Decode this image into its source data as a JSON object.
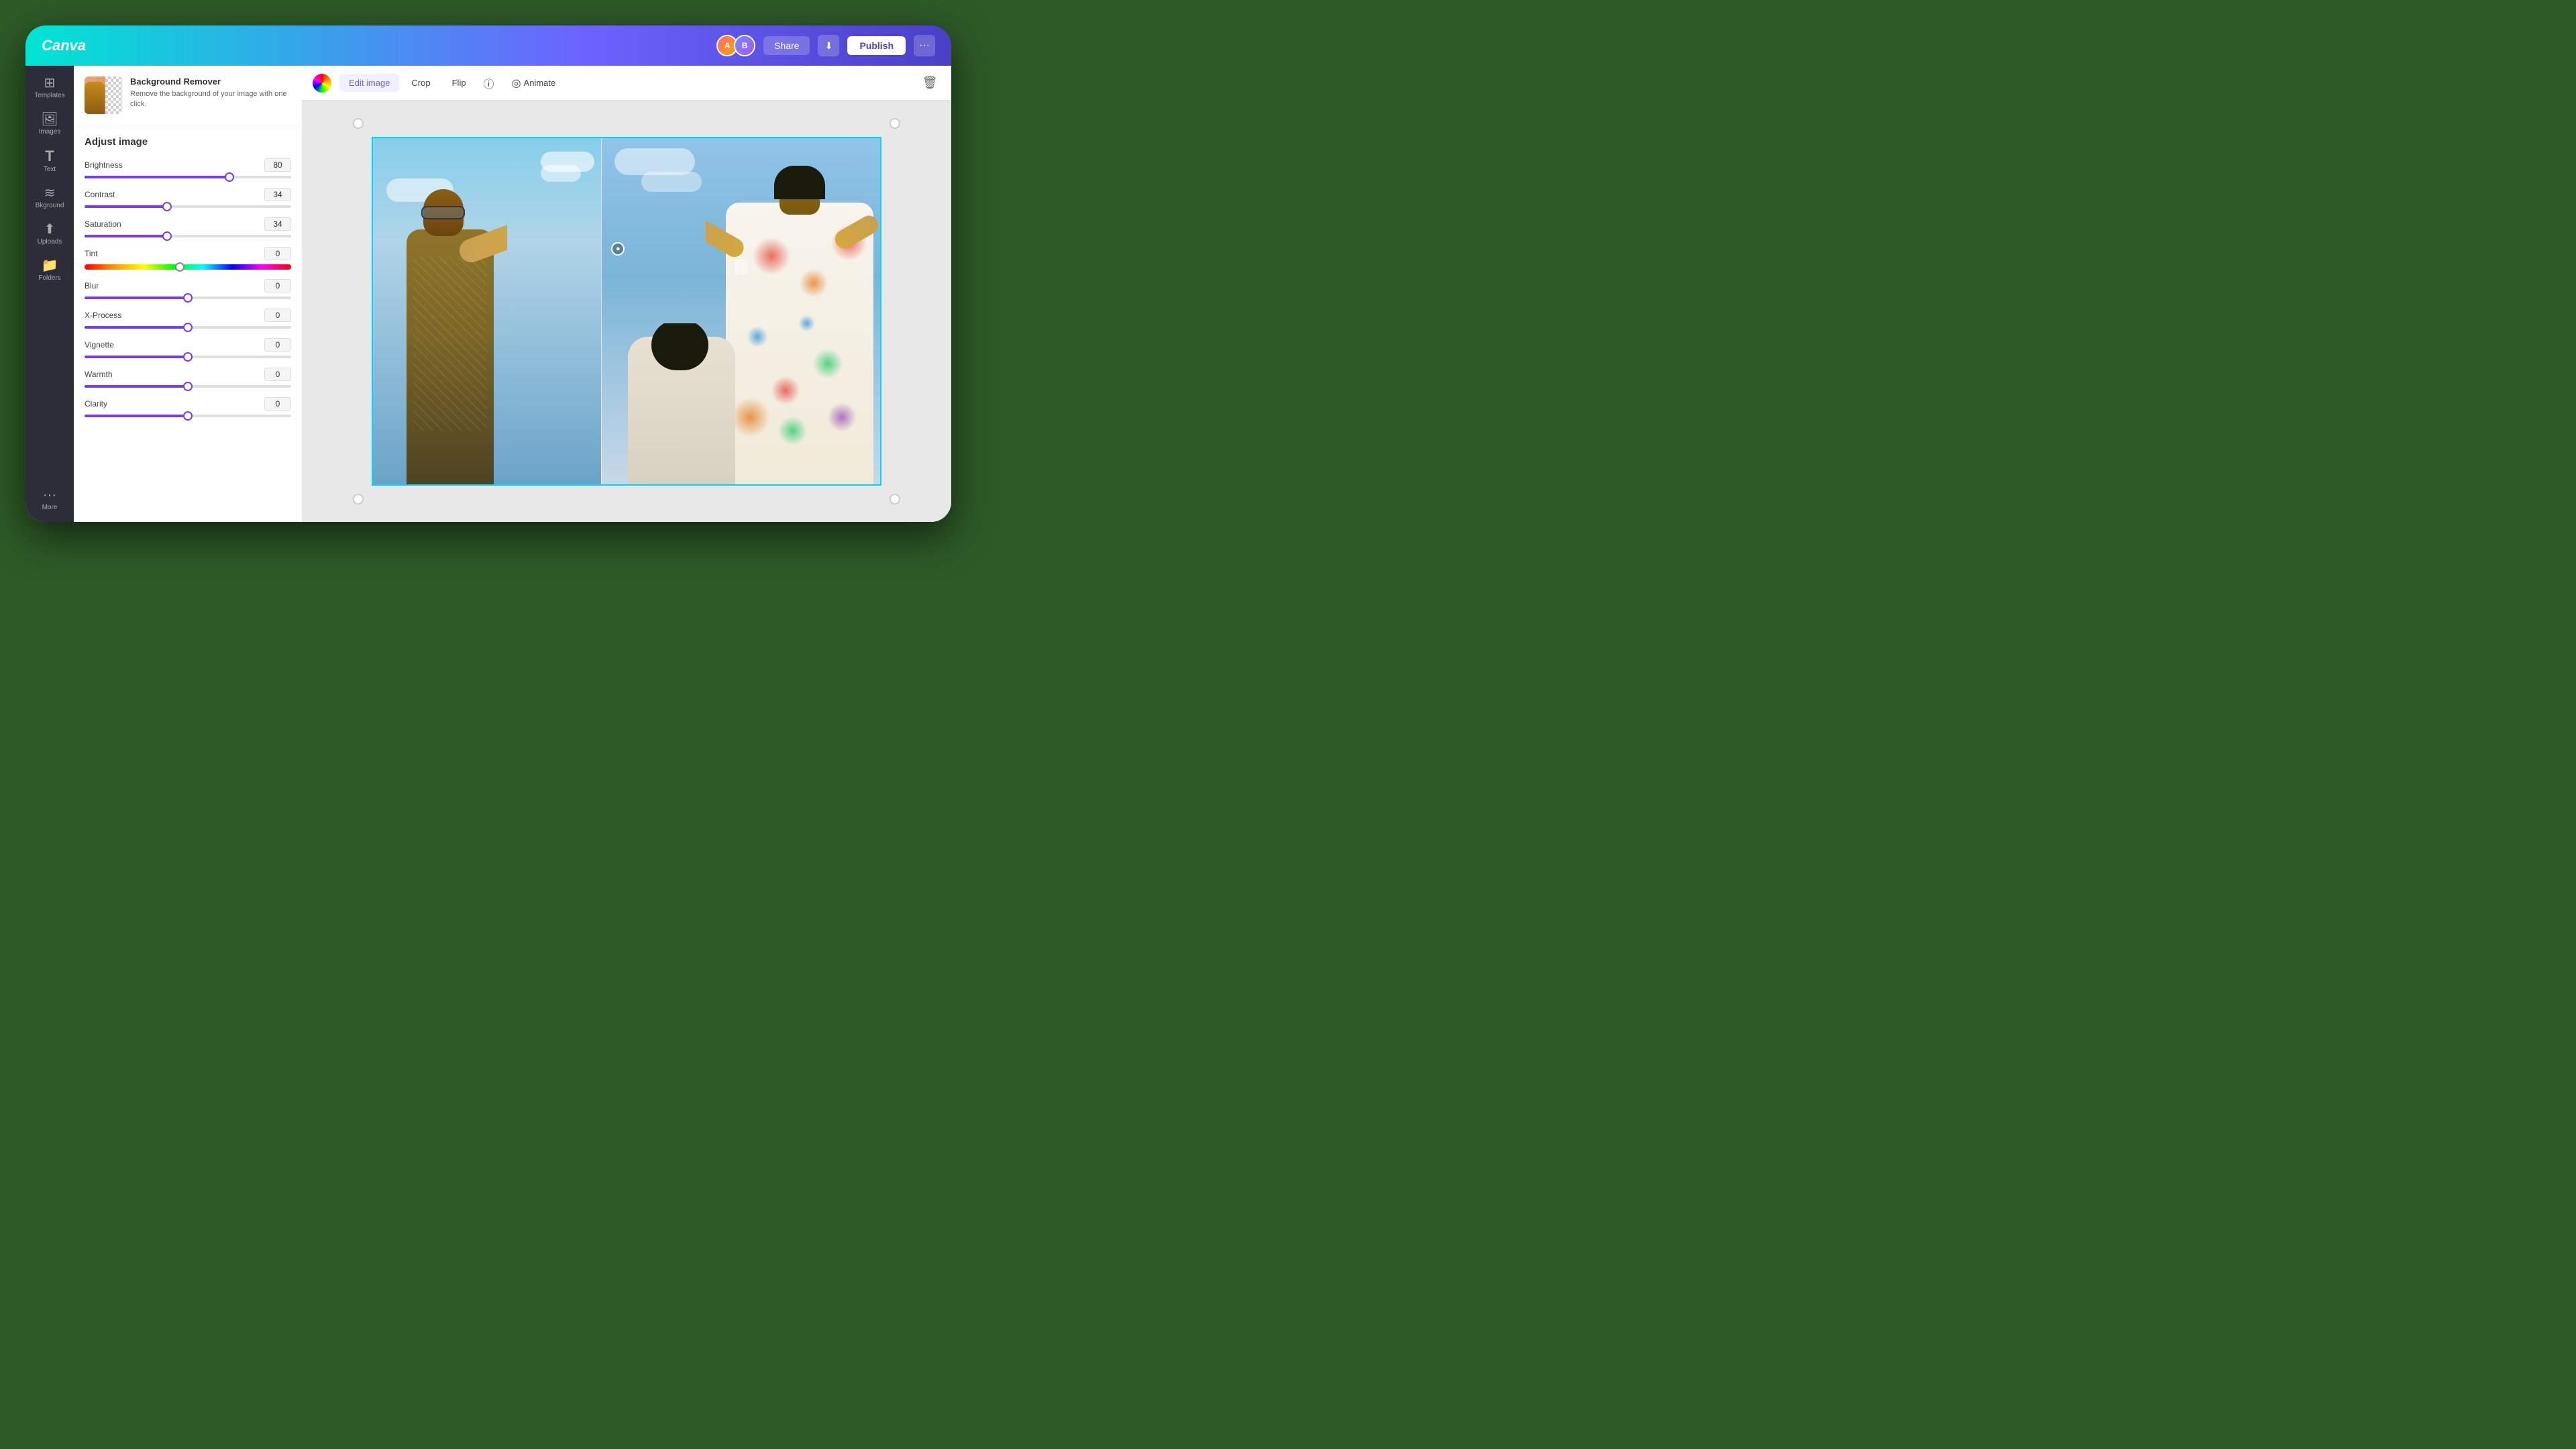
{
  "app": {
    "logo": "Canva"
  },
  "header": {
    "share_label": "Share",
    "publish_label": "Publish",
    "download_icon": "⬇",
    "more_icon": "···"
  },
  "sidebar": {
    "items": [
      {
        "id": "templates",
        "label": "Templates",
        "icon": "⊞"
      },
      {
        "id": "images",
        "label": "Images",
        "icon": "🖼"
      },
      {
        "id": "text",
        "label": "Text",
        "icon": "T"
      },
      {
        "id": "background",
        "label": "Bkground",
        "icon": "≋"
      },
      {
        "id": "uploads",
        "label": "Uploads",
        "icon": "⬆"
      },
      {
        "id": "folders",
        "label": "Folders",
        "icon": "📁"
      },
      {
        "id": "more",
        "label": "More",
        "icon": "···"
      }
    ]
  },
  "panel": {
    "bg_remover_title": "Background Remover",
    "bg_remover_desc": "Remove the background of your image with one click.",
    "adjust_title": "Adjust image",
    "sliders": [
      {
        "id": "brightness",
        "label": "Brightness",
        "value": "80",
        "fill_pct": 70,
        "type": "purple"
      },
      {
        "id": "contrast",
        "label": "Contrast",
        "value": "34",
        "fill_pct": 40,
        "type": "purple"
      },
      {
        "id": "saturation",
        "label": "Saturation",
        "value": "34",
        "fill_pct": 40,
        "type": "purple"
      },
      {
        "id": "tint",
        "label": "Tint",
        "value": "0",
        "fill_pct": 46,
        "type": "tint"
      },
      {
        "id": "blur",
        "label": "Blur",
        "value": "0",
        "fill_pct": 50,
        "type": "purple"
      },
      {
        "id": "xprocess",
        "label": "X-Process",
        "value": "0",
        "fill_pct": 50,
        "type": "purple"
      },
      {
        "id": "vignette",
        "label": "Vignette",
        "value": "0",
        "fill_pct": 50,
        "type": "purple"
      },
      {
        "id": "warmth",
        "label": "Warmth",
        "value": "0",
        "fill_pct": 50,
        "type": "purple"
      },
      {
        "id": "clarity",
        "label": "Clarity",
        "value": "0",
        "fill_pct": 50,
        "type": "purple"
      }
    ]
  },
  "toolbar": {
    "edit_image_label": "Edit image",
    "crop_label": "Crop",
    "flip_label": "Flip",
    "info_label": "ⓘ",
    "animate_label": "Animate",
    "delete_icon": "🗑"
  }
}
